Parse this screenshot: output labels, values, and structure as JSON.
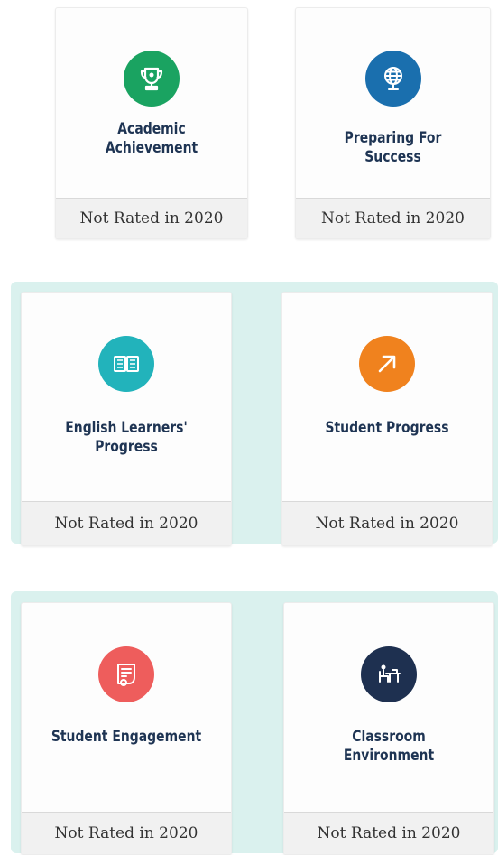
{
  "cards": [
    {
      "title": [
        "Academic",
        "Achievement"
      ],
      "status": "Not Rated in 2020",
      "icon": "trophy-icon",
      "color": "#1aa361"
    },
    {
      "title": [
        "Preparing For",
        "Success"
      ],
      "status": "Not Rated in 2020",
      "icon": "globe-icon",
      "color": "#1a6fae"
    },
    {
      "title": [
        "English Learners'",
        "Progress"
      ],
      "status": "Not Rated in 2020",
      "icon": "book-icon",
      "color": "#22b3bb"
    },
    {
      "title": [
        "Student Progress"
      ],
      "status": "Not Rated in 2020",
      "icon": "arrow-up-right-icon",
      "color": "#f0821e"
    },
    {
      "title": [
        "Student Engagement"
      ],
      "status": "Not Rated in 2020",
      "icon": "certificate-icon",
      "color": "#ee5d5c"
    },
    {
      "title": [
        "Classroom",
        "Environment"
      ],
      "status": "Not Rated in 2020",
      "icon": "classroom-desk-icon",
      "color": "#1e3050"
    }
  ]
}
